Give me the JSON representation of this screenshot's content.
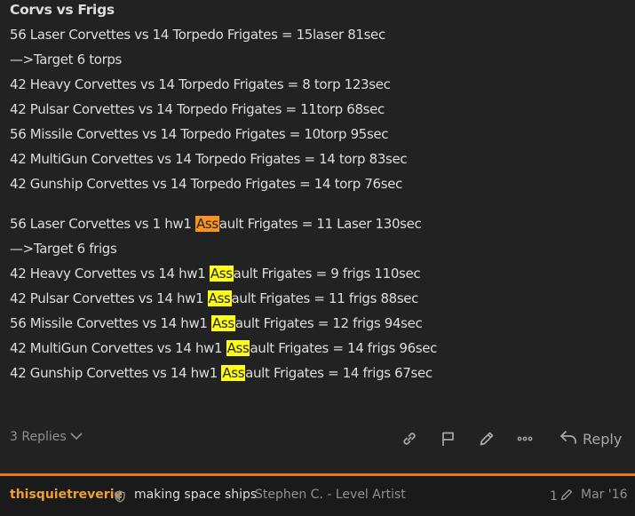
{
  "post": {
    "heading": "Corvs vs Frigs",
    "lines": [
      "56 Laser Corvettes vs 14 Torpedo Frigates = 15laser 81sec",
      "—>Target 6 torps",
      "42 Heavy Corvettes vs 14 Torpedo Frigates = 8 torp 123sec",
      "42 Pulsar Corvettes vs 14 Torpedo Frigates = 11torp 68sec",
      "56 Missile Corvettes vs 14 Torpedo Frigates = 10torp 95sec",
      "42 MultiGun Corvettes vs 14 Torpedo Frigates = 14 torp 83sec",
      "42 Gunship Corvettes vs 14 Torpedo Frigates = 14 torp 76sec"
    ],
    "assault_lines": [
      {
        "pre": "56 Laser Corvettes vs 1 hw1 ",
        "hl": "Ass",
        "post": "ault Frigates = 11 Laser 130sec",
        "color": "#f7941d"
      },
      {
        "pre": "—>Target 6 frigs",
        "hl": "",
        "post": "",
        "color": ""
      },
      {
        "pre": "42 Heavy Corvettes vs 14 hw1 ",
        "hl": "Ass",
        "post": "ault Frigates = 9 frigs 110sec",
        "color": "#ffff14"
      },
      {
        "pre": "42 Pulsar Corvettes vs 14 hw1 ",
        "hl": "Ass",
        "post": "ault Frigates = 11 frigs 88sec",
        "color": "#ffff14"
      },
      {
        "pre": "56 Missile Corvettes vs 14 hw1 ",
        "hl": "Ass",
        "post": "ault Frigates = 12 frigs 94sec",
        "color": "#ffff14"
      },
      {
        "pre": "42 MultiGun Corvettes vs 14 hw1 ",
        "hl": "Ass",
        "post": "ault Frigates = 14 frigs 96sec",
        "color": "#ffff14"
      },
      {
        "pre": "42 Gunship Corvettes vs 14 hw1 ",
        "hl": "Ass",
        "post": "ault Frigates = 14 frigs 67sec",
        "color": "#ffff14"
      }
    ]
  },
  "actions": {
    "replies_label": "3 Replies",
    "reply_label": "Reply",
    "icons": [
      "link-icon",
      "flag-icon",
      "pencil-icon",
      "more-icon",
      "reply-icon"
    ]
  },
  "footer": {
    "username": "thisquietreverie",
    "post_title": "making space ships",
    "user_title": "Stephen C. - Level Artist",
    "edit_count": "1",
    "date": "Mar '16"
  },
  "colors": {
    "background": "#222222",
    "text": "#dddddd",
    "muted": "#919191",
    "accent": "#e87a1e",
    "highlight": "#ffff14",
    "highlight_active": "#f7941d"
  }
}
